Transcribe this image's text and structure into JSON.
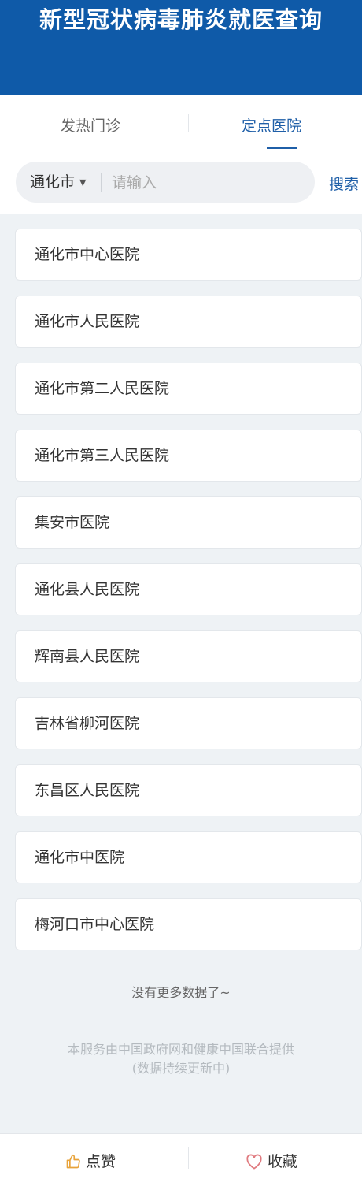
{
  "header": {
    "title": "新型冠状病毒肺炎就医查询"
  },
  "tabs": [
    {
      "label": "发热门诊"
    },
    {
      "label": "定点医院"
    }
  ],
  "search": {
    "city": "通化市",
    "placeholder": "请输入",
    "value": "",
    "button_label": "搜索"
  },
  "hospitals": [
    "通化市中心医院",
    "通化市人民医院",
    "通化市第二人民医院",
    "通化市第三人民医院",
    "集安市医院",
    "通化县人民医院",
    "辉南县人民医院",
    "吉林省柳河医院",
    "东昌区人民医院",
    "通化市中医院",
    "梅河口市中心医院"
  ],
  "no_more_text": "没有更多数据了~",
  "provider": {
    "line1": "本服务由中国政府网和健康中国联合提供",
    "line2": "(数据持续更新中)"
  },
  "footer": {
    "like_label": "点赞",
    "favorite_label": "收藏"
  },
  "colors": {
    "brand": "#0f5aa8",
    "accent": "#1f5fa8",
    "like_icon": "#e8a33a",
    "favorite_icon": "#e07b80"
  }
}
